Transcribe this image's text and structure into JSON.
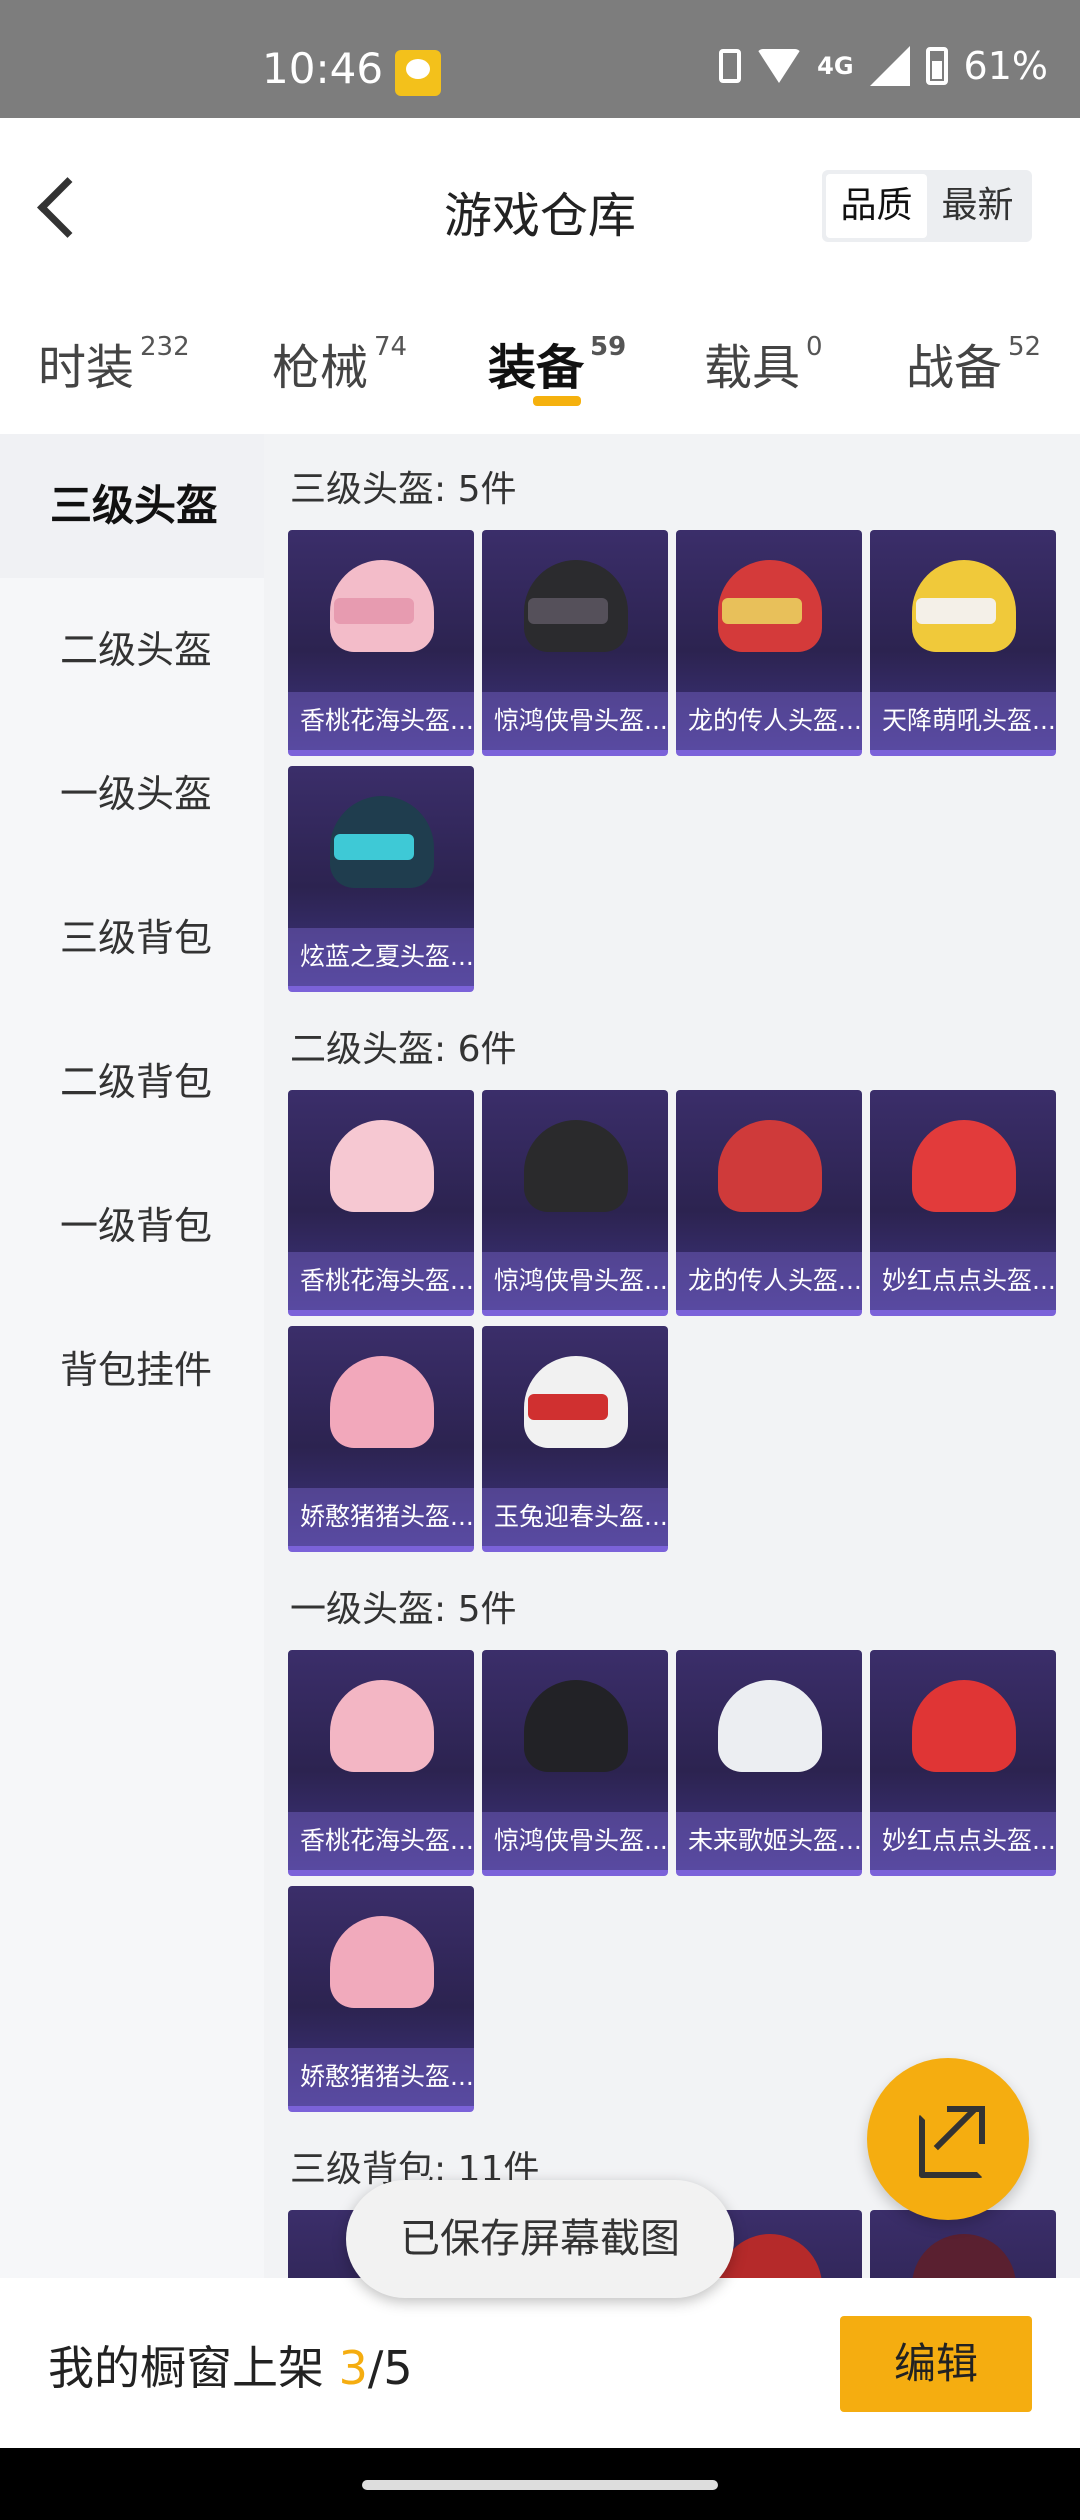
{
  "status_bar": {
    "time": "10:46",
    "network": "4G",
    "battery": "61%"
  },
  "header": {
    "title": "游戏仓库",
    "back_icon": "chevron-left-icon",
    "sort_options": [
      "品质",
      "最新"
    ],
    "sort_selected": "品质"
  },
  "tabs": [
    {
      "label": "时装",
      "count": "232"
    },
    {
      "label": "枪械",
      "count": "74"
    },
    {
      "label": "装备",
      "count": "59",
      "active": true
    },
    {
      "label": "载具",
      "count": "0"
    },
    {
      "label": "战备",
      "count": "52"
    }
  ],
  "sidebar": {
    "items": [
      "三级头盔",
      "二级头盔",
      "一级头盔",
      "三级背包",
      "二级背包",
      "一级背包",
      "背包挂件"
    ],
    "active": "三级头盔"
  },
  "sections": [
    {
      "title": "三级头盔: 5件",
      "items": [
        "香桃花海头盔...",
        "惊鸿侠骨头盔...",
        "龙的传人头盔...",
        "天降萌吼头盔...",
        "炫蓝之夏头盔..."
      ]
    },
    {
      "title": "二级头盔: 6件",
      "items": [
        "香桃花海头盔...",
        "惊鸿侠骨头盔...",
        "龙的传人头盔...",
        "妙红点点头盔...",
        "娇憨猪猪头盔...",
        "玉兔迎春头盔..."
      ]
    },
    {
      "title": "一级头盔: 5件",
      "items": [
        "香桃花海头盔...",
        "惊鸿侠骨头盔...",
        "未来歌姬头盔...",
        "妙红点点头盔...",
        "娇憨猪猪头盔..."
      ]
    },
    {
      "title": "三级背包: 11件"
    }
  ],
  "fab": {
    "icon": "share-external-icon"
  },
  "toast": "已保存屏幕截图",
  "bottom_bar": {
    "showcase_label": "我的橱窗上架",
    "showcase_current": "3",
    "showcase_sep": "/",
    "showcase_total": "5",
    "edit_label": "编辑"
  },
  "colors": {
    "accent": "#f5ad10",
    "card_bg": "#2c2350"
  }
}
